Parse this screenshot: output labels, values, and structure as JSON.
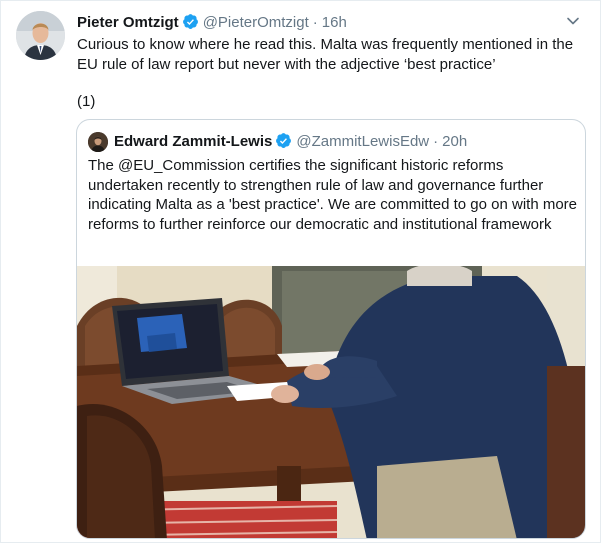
{
  "tweet": {
    "author_name": "Pieter Omtzigt",
    "author_handle": "@PieterOmtzigt",
    "separator": "·",
    "time": "16h",
    "text": "Curious to know where he read this. Malta was frequently mentioned in the EU rule of law report but never with the adjective ‘best practice’",
    "thread_counter": "(1)"
  },
  "quoted_tweet": {
    "author_name": "Edward Zammit-Lewis",
    "author_handle": "@ZammitLewisEdw",
    "separator": "·",
    "time": "20h",
    "text": "The @EU_Commission certifies the significant historic reforms undertaken recently to strengthen rule of law and governance further indicating Malta as a 'best practice'. We are committed to go on with more reforms to further reinforce our democratic and institutional framework"
  },
  "icons": {
    "verified": "verified-badge-icon",
    "more": "chevron-down-icon"
  },
  "colors": {
    "verified_blue": "#1da1f2",
    "secondary_text": "#657786",
    "border": "#ccd6dd"
  }
}
